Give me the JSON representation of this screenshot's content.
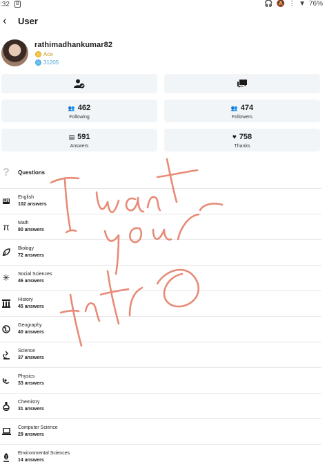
{
  "statusbar": {
    "time": ":32",
    "app_badge": "B",
    "battery": "76%"
  },
  "header": {
    "title": "User"
  },
  "profile": {
    "username": "rathimadhankumar82",
    "rank": "Ace",
    "points": "31205"
  },
  "stats": {
    "following": {
      "value": "462",
      "label": "Following"
    },
    "followers": {
      "value": "474",
      "label": "Followers"
    },
    "answers": {
      "value": "591",
      "label": "Answers"
    },
    "thanks": {
      "value": "758",
      "label": "Thanks"
    }
  },
  "questions": {
    "title": "Questions",
    "subjects": [
      {
        "name": "English",
        "count": "102 answers",
        "icon": "english-icon"
      },
      {
        "name": "Math",
        "count": "80 answers",
        "icon": "math-icon"
      },
      {
        "name": "Biology",
        "count": "72 answers",
        "icon": "biology-icon"
      },
      {
        "name": "Social Sciences",
        "count": "46 answers",
        "icon": "social-sciences-icon"
      },
      {
        "name": "History",
        "count": "45 answers",
        "icon": "history-icon"
      },
      {
        "name": "Geography",
        "count": "40 answers",
        "icon": "geography-icon"
      },
      {
        "name": "Science",
        "count": "37 answers",
        "icon": "science-icon"
      },
      {
        "name": "Physics",
        "count": "33 answers",
        "icon": "physics-icon"
      },
      {
        "name": "Chemistry",
        "count": "31 answers",
        "icon": "chemistry-icon"
      },
      {
        "name": "Computer Science",
        "count": "29 answers",
        "icon": "computer-science-icon"
      },
      {
        "name": "Environmental Sciences",
        "count": "14 answers",
        "icon": "environmental-sciences-icon"
      }
    ]
  },
  "scrawl_color": "#e88a76"
}
